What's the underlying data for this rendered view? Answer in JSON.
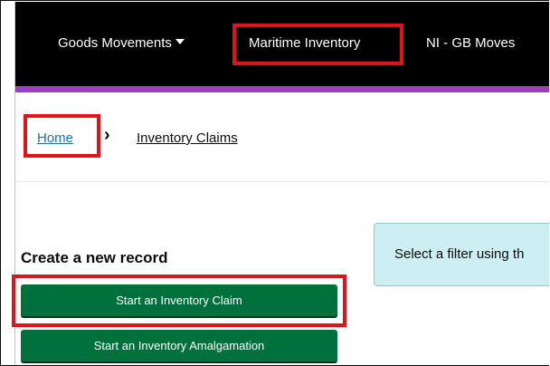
{
  "nav": {
    "items": [
      {
        "label": "Goods Movements",
        "has_dropdown": true
      },
      {
        "label": "Maritime Inventory",
        "highlighted": true
      },
      {
        "label": "NI - GB Moves"
      }
    ]
  },
  "breadcrumb": {
    "home": "Home",
    "separator": "›",
    "current": "Inventory Claims"
  },
  "create": {
    "heading": "Create a new record",
    "start_claim": "Start an Inventory Claim",
    "start_amalgamation": "Start an Inventory Amalgamation"
  },
  "filter": {
    "text": "Select a filter using th"
  },
  "colors": {
    "nav_bg": "#000000",
    "accent_bar": "#9c3ec2",
    "highlight_box": "#e1131a",
    "button_green": "#00703c",
    "link_blue": "#1d70b8",
    "info_bg": "#cdeef3"
  }
}
